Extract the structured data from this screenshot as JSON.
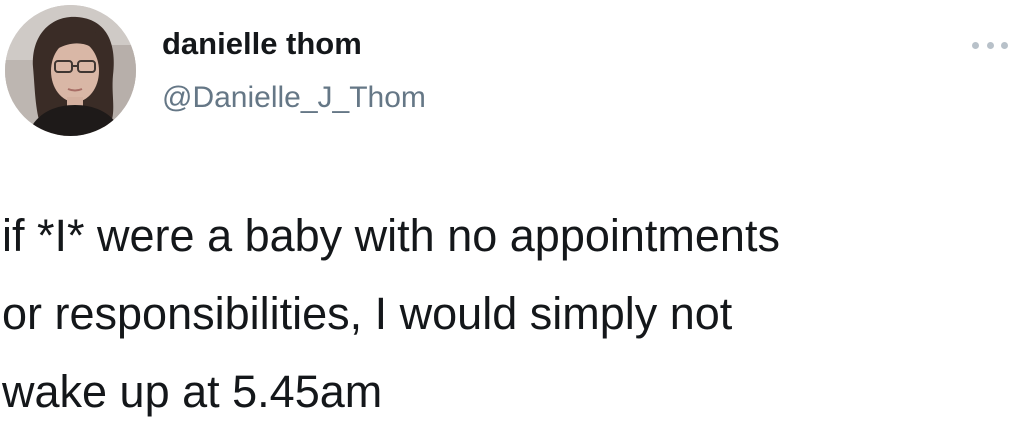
{
  "tweet": {
    "author": {
      "display_name": "danielle thom",
      "handle": "@Danielle_J_Thom",
      "avatar_icon": "profile-photo"
    },
    "more_icon": "more-options-icon",
    "text_lines": [
      "if *I* were a baby with no appointments",
      "or responsibilities, I would simply not",
      "wake up at 5.45am"
    ]
  }
}
